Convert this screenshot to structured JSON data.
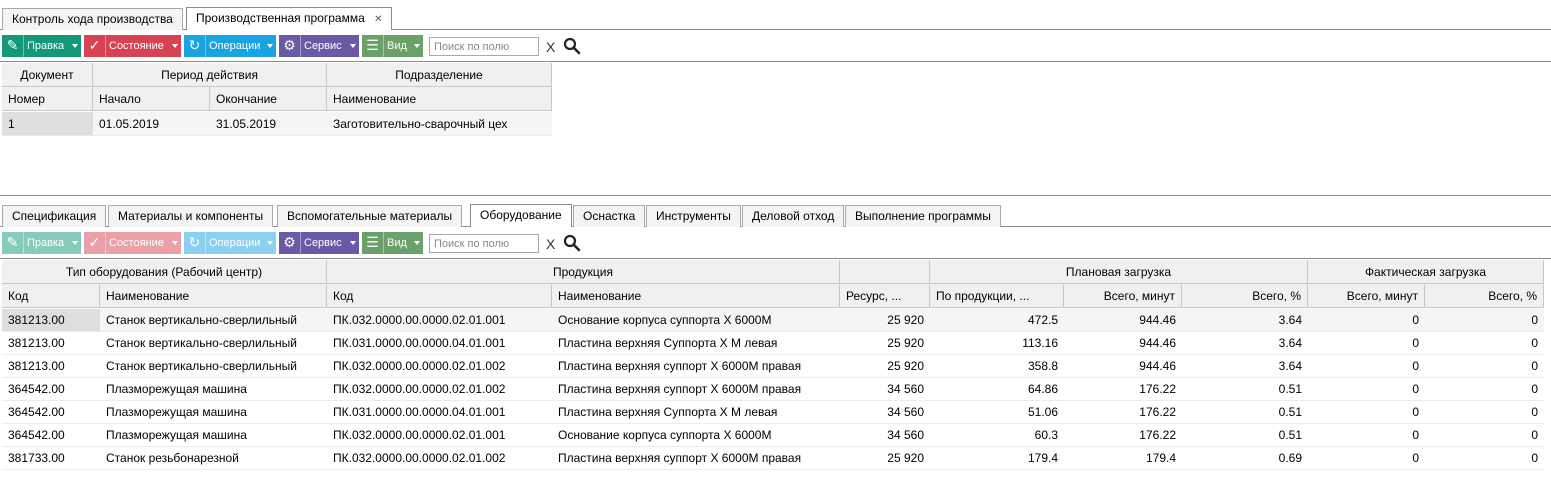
{
  "top_tabs": [
    {
      "label": "Контроль хода производства",
      "active": false
    },
    {
      "label": "Производственная программа",
      "active": true,
      "close": "✕"
    }
  ],
  "colors": {
    "pravka": "#14977a",
    "sostoyanie": "#d64352",
    "operacii": "#19a3e0",
    "servis": "#6a5aa6",
    "vid": "#6ba06a"
  },
  "toolbar_top": {
    "pravka": "Правка",
    "sostoyanie": "Состояние",
    "operacii": "Операции",
    "servis": "Сервис",
    "vid": "Вид",
    "search_placeholder": "Поиск по полю",
    "clear": "X"
  },
  "doc_table": {
    "group_headers": [
      "Документ",
      "Период действия",
      "Подразделение"
    ],
    "columns": [
      "Номер",
      "Начало",
      "Окончание",
      "Наименование"
    ],
    "rows": [
      [
        "1",
        "01.05.2019",
        "31.05.2019",
        "Заготовительно-сварочный цех"
      ]
    ]
  },
  "sub_tabs": [
    {
      "label": "Спецификация",
      "active": false
    },
    {
      "label": "Материалы и компоненты",
      "active": false
    },
    {
      "label": "Вспомогательные материалы",
      "active": false
    },
    {
      "label": "Оборудование",
      "active": true
    },
    {
      "label": "Оснастка",
      "active": false
    },
    {
      "label": "Инструменты",
      "active": false
    },
    {
      "label": "Деловой отход",
      "active": false
    },
    {
      "label": "Выполнение программы",
      "active": false
    }
  ],
  "toolbar_mid": {
    "pravka": "Правка",
    "sostoyanie": "Состояние",
    "operacii": "Операции",
    "servis": "Сервис",
    "vid": "Вид",
    "search_placeholder": "Поиск по полю",
    "clear": "X"
  },
  "equip_table": {
    "group_headers": [
      "Тип оборудования (Рабочий центр)",
      "Продукция",
      "Плановая загрузка",
      "Фактическая загрузка"
    ],
    "columns": [
      "Код",
      "Наименование",
      "Код",
      "Наименование",
      "Ресурс, ...",
      "По продукции, ...",
      "Всего, минут",
      "Всего, %",
      "Всего, минут",
      "Всего, %"
    ],
    "rows": [
      [
        "381213.00",
        "Станок вертикально-сверлильный",
        "ПК.032.0000.00.0000.02.01.001",
        "Основание корпуса суппорта X 6000M",
        "25 920",
        "472.5",
        "944.46",
        "3.64",
        "0",
        "0"
      ],
      [
        "381213.00",
        "Станок вертикально-сверлильный",
        "ПК.031.0000.00.0000.04.01.001",
        "Пластина верхняя Суппорта X M левая",
        "25 920",
        "113.16",
        "944.46",
        "3.64",
        "0",
        "0"
      ],
      [
        "381213.00",
        "Станок вертикально-сверлильный",
        "ПК.032.0000.00.0000.02.01.002",
        "Пластина верхняя суппорт X 6000M правая",
        "25 920",
        "358.8",
        "944.46",
        "3.64",
        "0",
        "0"
      ],
      [
        "364542.00",
        "Плазморежущая машина",
        "ПК.032.0000.00.0000.02.01.002",
        "Пластина верхняя суппорт X 6000M правая",
        "34 560",
        "64.86",
        "176.22",
        "0.51",
        "0",
        "0"
      ],
      [
        "364542.00",
        "Плазморежущая машина",
        "ПК.031.0000.00.0000.04.01.001",
        "Пластина верхняя Суппорта X M левая",
        "34 560",
        "51.06",
        "176.22",
        "0.51",
        "0",
        "0"
      ],
      [
        "364542.00",
        "Плазморежущая машина",
        "ПК.032.0000.00.0000.02.01.001",
        "Основание корпуса суппорта X 6000M",
        "34 560",
        "60.3",
        "176.22",
        "0.51",
        "0",
        "0"
      ],
      [
        "381733.00",
        "Станок резьбонарезной",
        "ПК.032.0000.00.0000.02.01.002",
        "Пластина верхняя суппорт X 6000M правая",
        "25 920",
        "179.4",
        "179.4",
        "0.69",
        "0",
        "0"
      ]
    ]
  }
}
